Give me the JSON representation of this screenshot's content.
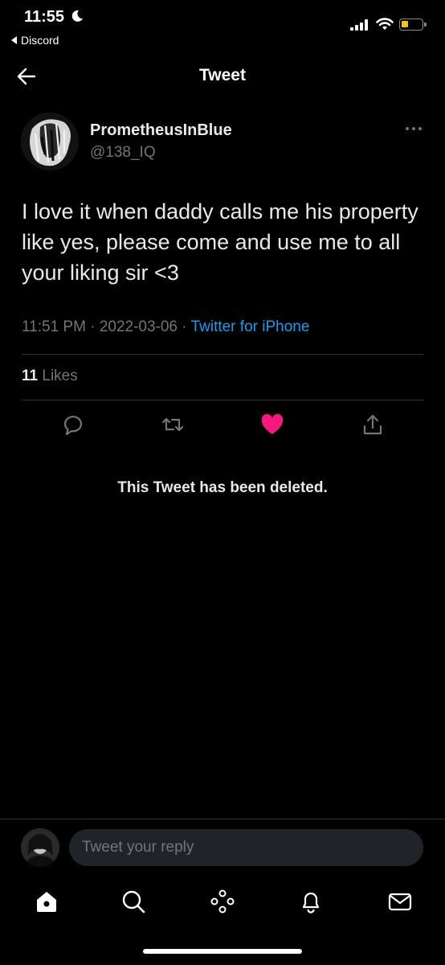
{
  "status_bar": {
    "time": "11:55",
    "back_app": "Discord"
  },
  "header": {
    "title": "Tweet"
  },
  "tweet": {
    "display_name": "PrometheusInBlue",
    "handle": "@138_IQ",
    "text": "I love it when daddy calls me his property like yes, please come and use me to all your liking sir <3",
    "time": "11:51 PM",
    "separator": " · ",
    "date": "2022-03-06",
    "source": "Twitter for iPhone",
    "likes_count": "11",
    "likes_label": "Likes",
    "liked": true
  },
  "quoted_notice": "This Tweet has been deleted.",
  "reply": {
    "placeholder": "Tweet your reply"
  },
  "colors": {
    "accent": "#1d9bf0",
    "like": "#f91880",
    "battery": "#f3c318",
    "background": "#000000"
  },
  "icons": {
    "actions": [
      "reply-icon",
      "retweet-icon",
      "like-icon",
      "share-icon"
    ],
    "tabs": [
      "home-icon",
      "search-icon",
      "spaces-icon",
      "notifications-icon",
      "messages-icon"
    ]
  }
}
